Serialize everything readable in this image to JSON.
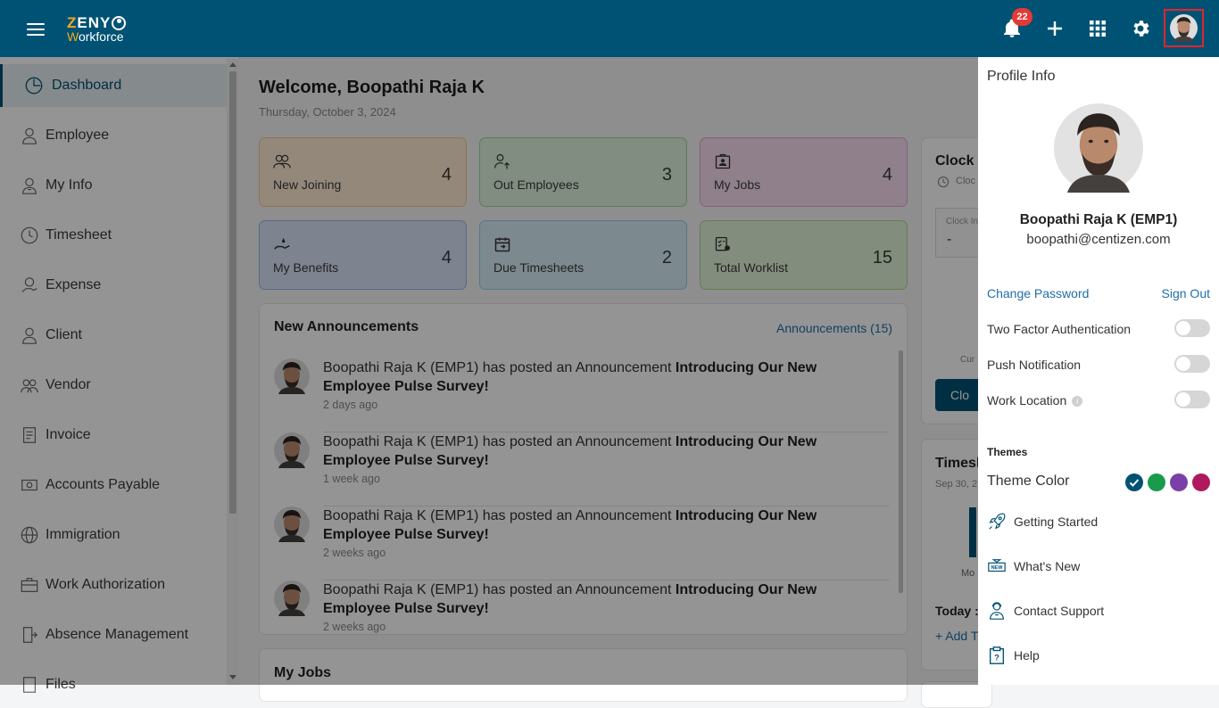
{
  "app": {
    "logo_line1": "ZENY",
    "logo_line2": "Workforce"
  },
  "header": {
    "notification_count": "22"
  },
  "sidebar": {
    "items": [
      {
        "label": "Dashboard",
        "icon": "dashboard-icon"
      },
      {
        "label": "Employee",
        "icon": "employee-icon"
      },
      {
        "label": "My Info",
        "icon": "my-info-icon"
      },
      {
        "label": "Timesheet",
        "icon": "clock-icon"
      },
      {
        "label": "Expense",
        "icon": "expense-icon"
      },
      {
        "label": "Client",
        "icon": "client-icon"
      },
      {
        "label": "Vendor",
        "icon": "vendor-icon"
      },
      {
        "label": "Invoice",
        "icon": "invoice-icon"
      },
      {
        "label": "Accounts Payable",
        "icon": "accounts-payable-icon"
      },
      {
        "label": "Immigration",
        "icon": "globe-icon"
      },
      {
        "label": "Work Authorization",
        "icon": "briefcase-icon"
      },
      {
        "label": "Absence Management",
        "icon": "absence-icon"
      },
      {
        "label": "Files",
        "icon": "files-icon"
      }
    ]
  },
  "main": {
    "welcome": "Welcome, Boopathi Raja K",
    "date": "Thursday, October 3, 2024",
    "cards": [
      {
        "label": "New Joining",
        "value": "4"
      },
      {
        "label": "Out Employees",
        "value": "3"
      },
      {
        "label": "My Jobs",
        "value": "4"
      },
      {
        "label": "My Benefits",
        "value": "4"
      },
      {
        "label": "Due Timesheets",
        "value": "2"
      },
      {
        "label": "Total Worklist",
        "value": "15"
      }
    ],
    "announcements": {
      "title": "New Announcements",
      "link": "Announcements (15)",
      "items": [
        {
          "prefix": "Boopathi Raja K (EMP1) has posted an Announcement ",
          "bold": "Introducing Our New Employee Pulse Survey!",
          "ago": "2 days ago"
        },
        {
          "prefix": "Boopathi Raja K (EMP1) has posted an Announcement ",
          "bold": "Introducing Our New Employee Pulse Survey!",
          "ago": "1 week ago"
        },
        {
          "prefix": "Boopathi Raja K (EMP1) has posted an Announcement ",
          "bold": "Introducing Our New Employee Pulse Survey!",
          "ago": "2 weeks ago"
        },
        {
          "prefix": "Boopathi Raja K (EMP1) has posted an Announcement ",
          "bold": "Introducing Our New Employee Pulse Survey!",
          "ago": "2 weeks ago"
        }
      ]
    },
    "my_jobs_title": "My Jobs",
    "clock": {
      "title": "Clock I",
      "sub": "Cloc",
      "box_label": "Clock In",
      "box_value": "-",
      "cur": "Cur",
      "btn": "Clo"
    },
    "timesheet": {
      "title": "Timesh",
      "date": "Sep 30, 2",
      "mo": "Mo",
      "today": "Today :",
      "add": "+ Add T"
    }
  },
  "profile": {
    "title": "Profile Info",
    "name": "Boopathi Raja K (EMP1)",
    "email": "boopathi@centizen.com",
    "change_password": "Change Password",
    "sign_out": "Sign Out",
    "toggles": [
      {
        "label": "Two Factor Authentication",
        "on": false
      },
      {
        "label": "Push Notification",
        "on": false
      },
      {
        "label": "Work Location",
        "on": false
      }
    ],
    "themes_heading": "Themes",
    "theme_color_label": "Theme Color",
    "theme_colors": [
      "#005274",
      "#1a9a4b",
      "#7b3fa8",
      "#b0195c"
    ],
    "menu": [
      {
        "label": "Getting Started",
        "icon": "rocket-icon"
      },
      {
        "label": "What's New",
        "icon": "new-icon"
      },
      {
        "label": "Contact Support",
        "icon": "support-icon"
      },
      {
        "label": "Help",
        "icon": "help-icon"
      }
    ]
  }
}
